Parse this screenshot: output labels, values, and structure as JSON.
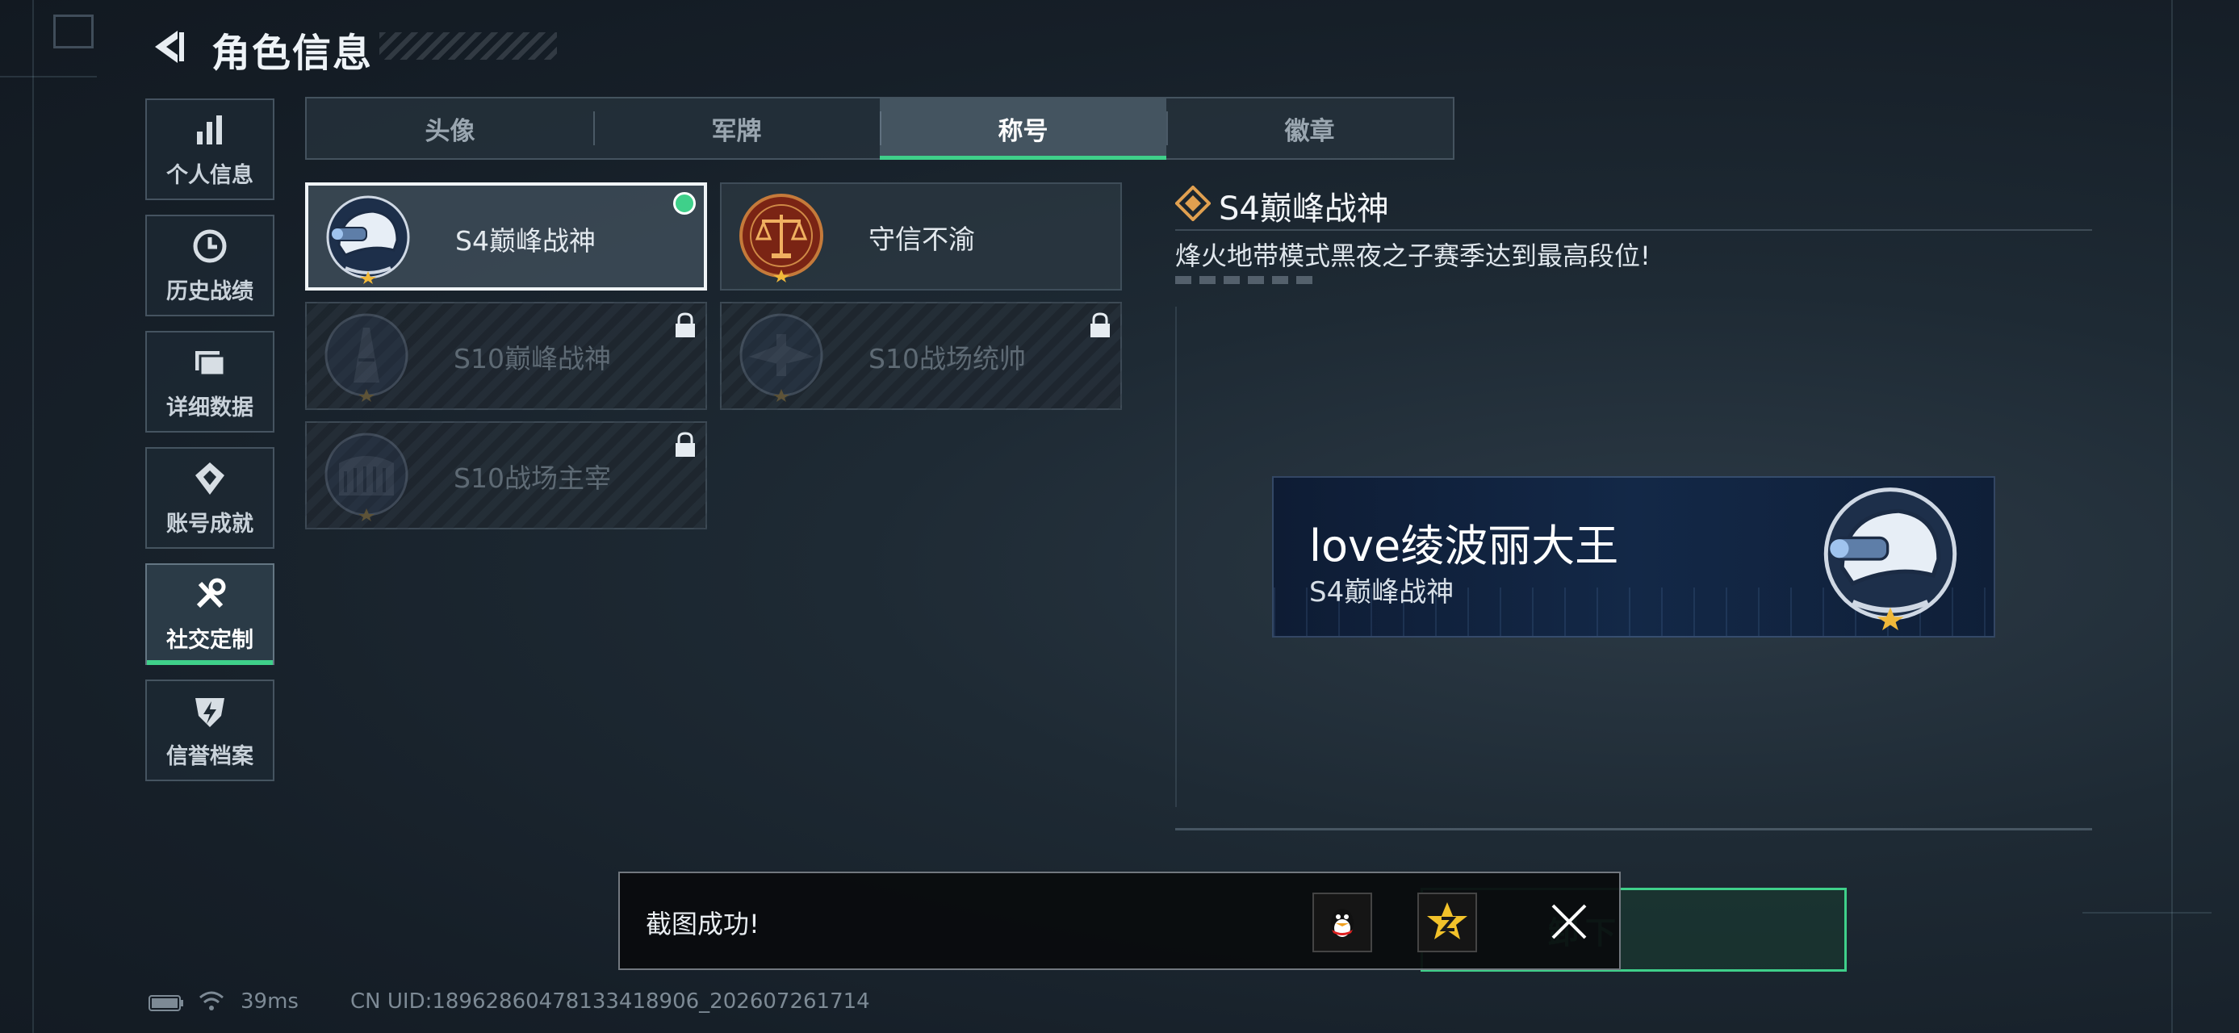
{
  "header": {
    "title": "角色信息"
  },
  "sidebar": {
    "items": [
      {
        "label": "个人信息",
        "icon": "bar-chart-icon",
        "active": false
      },
      {
        "label": "历史战绩",
        "icon": "clock-icon",
        "active": false
      },
      {
        "label": "详细数据",
        "icon": "folder-icon",
        "active": false
      },
      {
        "label": "账号成就",
        "icon": "achievement-icon",
        "active": false
      },
      {
        "label": "社交定制",
        "icon": "tools-icon",
        "active": true
      },
      {
        "label": "信誉档案",
        "icon": "shield-icon",
        "active": false
      }
    ]
  },
  "tabs": [
    {
      "label": "头像",
      "active": false
    },
    {
      "label": "军牌",
      "active": false
    },
    {
      "label": "称号",
      "active": true
    },
    {
      "label": "徽章",
      "active": false
    }
  ],
  "titles": [
    {
      "name": "S4巅峰战神",
      "emblem": "helmet-emblem-icon",
      "locked": false,
      "equipped": true
    },
    {
      "name": "守信不渝",
      "emblem": "scales-emblem-icon",
      "locked": false,
      "equipped": false
    },
    {
      "name": "S10巅峰战神",
      "emblem": "tower-emblem-icon",
      "locked": true,
      "equipped": false
    },
    {
      "name": "S10战场统帅",
      "emblem": "aircraft-emblem-icon",
      "locked": true,
      "equipped": false
    },
    {
      "name": "S10战场主宰",
      "emblem": "colosseum-emblem-icon",
      "locked": true,
      "equipped": false
    }
  ],
  "detail": {
    "title": "S4巅峰战神",
    "description": "烽火地带模式黑夜之子赛季达到最高段位!"
  },
  "preview": {
    "player_name": "love绫波丽大王",
    "title": "S4巅峰战神"
  },
  "unload_button": {
    "label": "卸下"
  },
  "toast": {
    "message": "截图成功!",
    "share_targets": [
      "qq-icon",
      "qzone-icon"
    ]
  },
  "status_bar": {
    "ping": "39ms",
    "uid": "CN UID:18962860478133418906_202607261714"
  },
  "colors": {
    "accent": "#3fd08a",
    "background": "#1a2430"
  }
}
